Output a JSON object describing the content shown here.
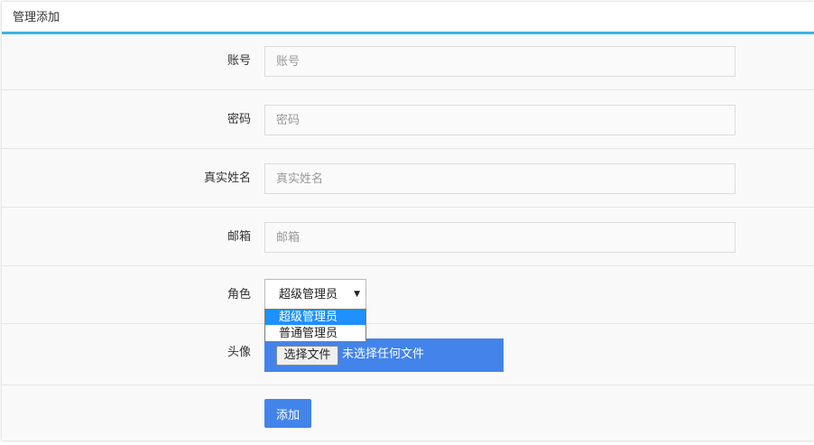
{
  "panel": {
    "title": "管理添加"
  },
  "form": {
    "account": {
      "label": "账号",
      "placeholder": "账号",
      "value": ""
    },
    "password": {
      "label": "密码",
      "placeholder": "密码",
      "value": ""
    },
    "realname": {
      "label": "真实姓名",
      "placeholder": "真实姓名",
      "value": ""
    },
    "email": {
      "label": "邮箱",
      "placeholder": "邮箱",
      "value": ""
    },
    "role": {
      "label": "角色",
      "selected": "超级管理员",
      "options": [
        "超级管理员",
        "普通管理员"
      ],
      "highlighted_index": 0,
      "expanded": true
    },
    "avatar": {
      "label": "头像",
      "button_label": "选择文件",
      "status": "未选择任何文件"
    },
    "submit_label": "添加"
  },
  "colors": {
    "accent": "#3bb4e5",
    "primary_button": "#4384ea",
    "option_highlight": "#1e90ff"
  },
  "icons": {
    "select_arrow": "triangle-down-icon"
  }
}
